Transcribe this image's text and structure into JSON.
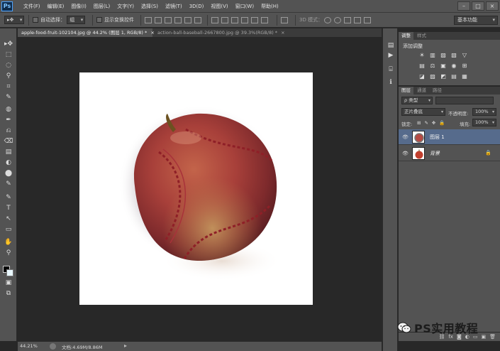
{
  "app": {
    "logo": "Ps"
  },
  "menu": [
    "文件(F)",
    "编辑(E)",
    "图像(I)",
    "图层(L)",
    "文字(Y)",
    "选择(S)",
    "滤镜(T)",
    "3D(D)",
    "视图(V)",
    "窗口(W)",
    "帮助(H)"
  ],
  "window_controls": [
    "–",
    "□",
    "×"
  ],
  "options": {
    "auto_select_label": "自动选择：",
    "auto_select_value": "组",
    "show_transform_label": "显示变换控件",
    "mode_3d_label": "3D 模式：",
    "workspace": "基本功能"
  },
  "tabs": [
    {
      "label": "apple-food-fruit-102104.jpg @ 44.2% (图层 1, RGB/8) *",
      "close": "×"
    },
    {
      "label": "action-ball-baseball-2667800.jpg @ 39.3%(RGB/8) *",
      "close": "×"
    }
  ],
  "status": {
    "zoom": "44.21%",
    "doc": "文档:4.69M/8.86M",
    "arrow": "▸"
  },
  "tools": [
    "▸✥",
    "⬚",
    "◌",
    "⚲",
    "⌗",
    "✎",
    "◍",
    "✒",
    "⎌",
    "⌫",
    "▤",
    "◐",
    "⬤",
    "✎",
    "T",
    "↖",
    "▭",
    "✋",
    "⚲",
    "▣",
    "⧉"
  ],
  "dock_icons": [
    "▤",
    "▶",
    "⌸",
    "ℹ"
  ],
  "adjust_panel": {
    "tabs": [
      "调整",
      "样式"
    ],
    "title": "添加调整",
    "row1": [
      "☀",
      "▥",
      "▨",
      "▧",
      "▽"
    ],
    "row2": [
      "▤",
      "⚖",
      "▣",
      "◉",
      "⊞"
    ],
    "row3": [
      "◪",
      "▨",
      "◩",
      "▤",
      "▦"
    ]
  },
  "layers_panel": {
    "tabs": [
      "图层",
      "通道",
      "路径"
    ],
    "filter_kind": "ρ 类型",
    "blend_mode": "正片叠底",
    "opacity_label": "不透明度:",
    "opacity_value": "100%",
    "lock_label": "锁定:",
    "fill_label": "填充:",
    "fill_value": "100%",
    "layers": [
      {
        "name": "图层 1",
        "selected": true
      },
      {
        "name": "背景",
        "selected": false,
        "locked": true
      }
    ],
    "bottom_icons": [
      "⛓",
      "fx",
      "◙",
      "◐",
      "▭",
      "▣",
      "🗑"
    ]
  },
  "watermark": "PS实用教程"
}
